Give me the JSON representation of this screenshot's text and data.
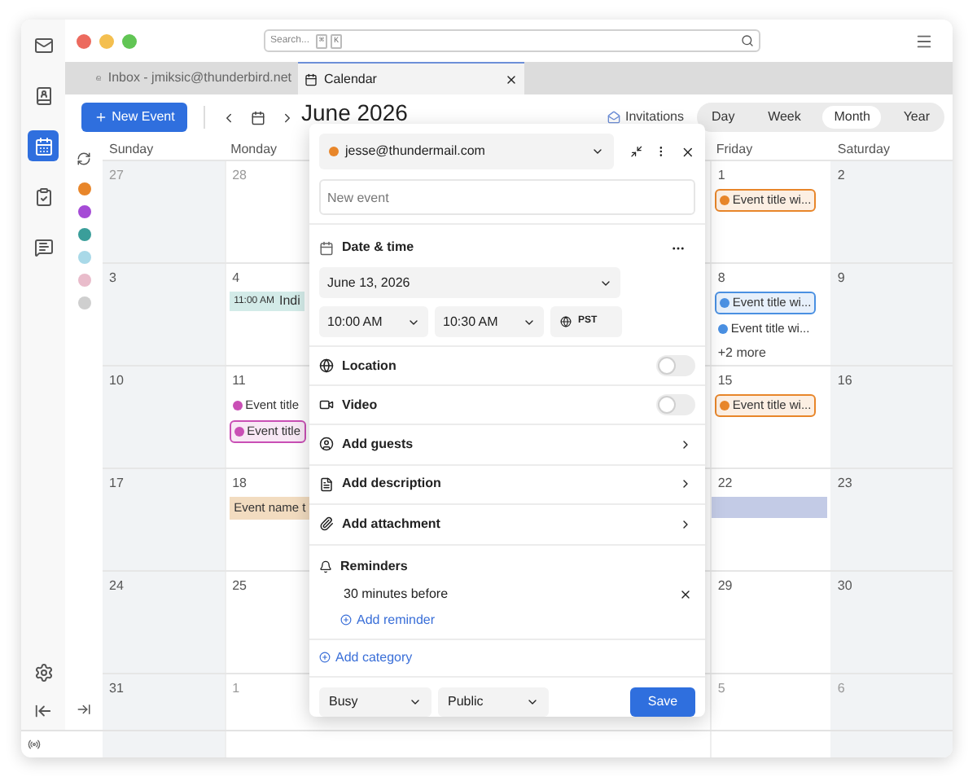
{
  "app_nav": [
    {
      "kind": "mail",
      "selected": false
    },
    {
      "kind": "contacts",
      "selected": false
    },
    {
      "kind": "calendar",
      "selected": true
    },
    {
      "kind": "tasks",
      "selected": false
    },
    {
      "kind": "chat",
      "selected": false
    }
  ],
  "search": {
    "placeholder": "Search...",
    "keys": [
      "⌘",
      "K"
    ]
  },
  "tabs": [
    {
      "kind": "mail",
      "label": "Inbox - jmiksic@thunderbird.net",
      "selected": false
    },
    {
      "kind": "calendar",
      "label": "Calendar",
      "selected": true
    }
  ],
  "toolbar": {
    "new_event": "New Event",
    "title": "June 2026",
    "invitations": "Invitations",
    "views": [
      {
        "label": "Day",
        "selected": false
      },
      {
        "label": "Week",
        "selected": false
      },
      {
        "label": "Month",
        "selected": true
      },
      {
        "label": "Year",
        "selected": false
      }
    ]
  },
  "calendars": [
    {
      "color": "#e8862a"
    },
    {
      "color": "#a54bd6"
    },
    {
      "color": "#3a9e9a"
    },
    {
      "color": "#a9d9e8"
    },
    {
      "color": "#e9bccb"
    },
    {
      "color": "#cfcfcf"
    }
  ],
  "weekdays": {
    "left": [
      "Sunday",
      "Monday"
    ],
    "right": [
      "Friday",
      "Saturday"
    ]
  },
  "weeks": [
    {
      "left": [
        {
          "day": "27",
          "outside": true
        },
        {
          "day": "28",
          "outside": true
        }
      ],
      "right": [
        {
          "day": "1",
          "outside": false,
          "events": [
            {
              "kind": "chip",
              "title": "Event title wi...",
              "color": "#e8862a"
            }
          ]
        },
        {
          "day": "2",
          "outside": false
        }
      ]
    },
    {
      "left": [
        {
          "day": "3",
          "outside": false
        },
        {
          "day": "4",
          "outside": false,
          "events": [
            {
              "kind": "timed",
              "time": "11:00 AM",
              "title": "Indi",
              "color": "#d3ebe8"
            }
          ]
        }
      ],
      "right": [
        {
          "day": "8",
          "outside": false,
          "events": [
            {
              "kind": "chip",
              "title": "Event title wi...",
              "color": "#4a90e2"
            },
            {
              "kind": "plain",
              "title": "Event title wi...",
              "color": "#4a90e2"
            },
            {
              "kind": "more",
              "title": "+2 more"
            }
          ]
        },
        {
          "day": "9",
          "outside": false
        }
      ]
    },
    {
      "left": [
        {
          "day": "10",
          "outside": false
        },
        {
          "day": "11",
          "outside": false,
          "events": [
            {
              "kind": "plain",
              "title": "Event title",
              "color": "#c94fb5"
            },
            {
              "kind": "chip",
              "title": "Event title",
              "color": "#c94fb5"
            }
          ]
        }
      ],
      "right": [
        {
          "day": "15",
          "outside": false,
          "events": [
            {
              "kind": "chip",
              "title": "Event title wi...",
              "color": "#e8862a"
            }
          ]
        },
        {
          "day": "16",
          "outside": false
        }
      ]
    },
    {
      "left": [
        {
          "day": "17",
          "outside": false
        },
        {
          "day": "18",
          "outside": false,
          "events": [
            {
              "kind": "block",
              "title": "Event name t",
              "color": "#f2dcc0"
            }
          ]
        }
      ],
      "right": [
        {
          "day": "22",
          "outside": false,
          "events": [
            {
              "kind": "bar",
              "color": "#c3cbe6"
            }
          ]
        },
        {
          "day": "23",
          "outside": false
        }
      ]
    },
    {
      "left": [
        {
          "day": "24",
          "outside": false
        },
        {
          "day": "25",
          "outside": false
        }
      ],
      "right": [
        {
          "day": "29",
          "outside": false
        },
        {
          "day": "30",
          "outside": false
        }
      ]
    },
    {
      "left": [
        {
          "day": "31",
          "outside": false
        },
        {
          "day": "1",
          "outside": true
        }
      ],
      "right": [
        {
          "day": "5",
          "outside": true
        },
        {
          "day": "6",
          "outside": true
        }
      ]
    }
  ],
  "event_editor": {
    "calendar": {
      "label": "jesse@thundermail.com",
      "color": "#e8862a"
    },
    "title_field": {
      "placeholder": "New event"
    },
    "date_time": {
      "heading": "Date & time",
      "date": "June 13, 2026",
      "start": "10:00 AM",
      "end": "10:30 AM",
      "timezone": "PST"
    },
    "toggles": [
      {
        "kind": "location",
        "label": "Location",
        "on": false
      },
      {
        "kind": "video",
        "label": "Video",
        "on": false
      }
    ],
    "links": [
      {
        "kind": "guests",
        "label": "Add guests"
      },
      {
        "kind": "description",
        "label": "Add description"
      },
      {
        "kind": "attachment",
        "label": "Add attachment"
      }
    ],
    "reminders": {
      "heading": "Reminders",
      "items": [
        "30 minutes before"
      ],
      "add": "Add reminder"
    },
    "add_category": "Add category",
    "status": "Busy",
    "visibility": "Public",
    "save": "Save"
  }
}
